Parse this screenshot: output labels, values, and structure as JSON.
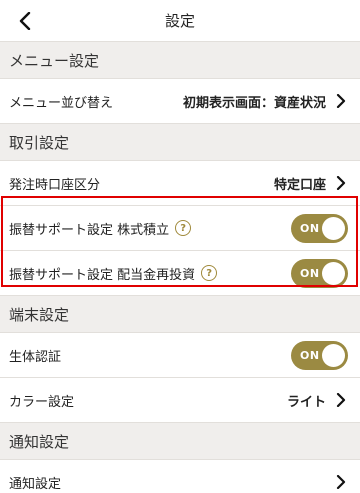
{
  "header": {
    "title": "設定",
    "back_icon": "chevron-left-icon"
  },
  "sections": {
    "menu": {
      "title": "メニュー設定",
      "rows": {
        "reorder": {
          "label": "メニュー並び替え",
          "value": "初期表示画面：資産状況"
        }
      }
    },
    "trade": {
      "title": "取引設定",
      "rows": {
        "account": {
          "label": "発注時口座区分",
          "value": "特定口座"
        },
        "transfer_stock": {
          "label": "振替サポート設定 株式積立",
          "toggle": "ON"
        },
        "transfer_dividend": {
          "label": "振替サポート設定 配当金再投資",
          "toggle": "ON"
        }
      }
    },
    "device": {
      "title": "端末設定",
      "rows": {
        "biometric": {
          "label": "生体認証",
          "toggle": "ON"
        },
        "color": {
          "label": "カラー設定",
          "value": "ライト"
        }
      }
    },
    "notify": {
      "title": "通知設定",
      "rows": {
        "notify": {
          "label": "通知設定"
        }
      }
    }
  },
  "help_glyph": "?",
  "colors": {
    "accent": "#9b8a42",
    "highlight": "#e00000",
    "section_bg": "#f0eeec"
  }
}
